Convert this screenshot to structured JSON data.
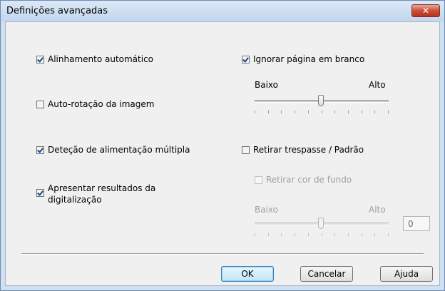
{
  "window": {
    "title": "Definições avançadas",
    "close_icon": "close-icon"
  },
  "options": {
    "auto_align": {
      "label": "Alinhamento automático",
      "checked": true
    },
    "skip_blank": {
      "label": "Ignorar página em branco",
      "checked": true
    },
    "skip_blank_slider": {
      "low_label": "Baixo",
      "high_label": "Alto",
      "level": 0.5
    },
    "auto_rotate": {
      "label": "Auto-rotação da imagem",
      "checked": false
    },
    "multifeed": {
      "label": "Deteção de alimentação múltipla",
      "checked": true
    },
    "bleed_through": {
      "label": "Retirar trespasse / Padrão",
      "checked": false
    },
    "remove_bg": {
      "label": "Retirar cor de fundo",
      "checked": false,
      "disabled": true
    },
    "bg_slider": {
      "low_label": "Baixo",
      "high_label": "Alto",
      "level": 0.5,
      "value": "0"
    },
    "show_results": {
      "label_line1": "Apresentar resultados da",
      "label_line2": "digitalização",
      "checked": true
    }
  },
  "buttons": {
    "ok": "OK",
    "cancel": "Cancelar",
    "help": "Ajuda"
  },
  "colors": {
    "window_frame": "#cfe0f3",
    "dialog_body": "#f0f0f0",
    "close_button": "#c9503a",
    "check_mark": "#1c3f94"
  }
}
